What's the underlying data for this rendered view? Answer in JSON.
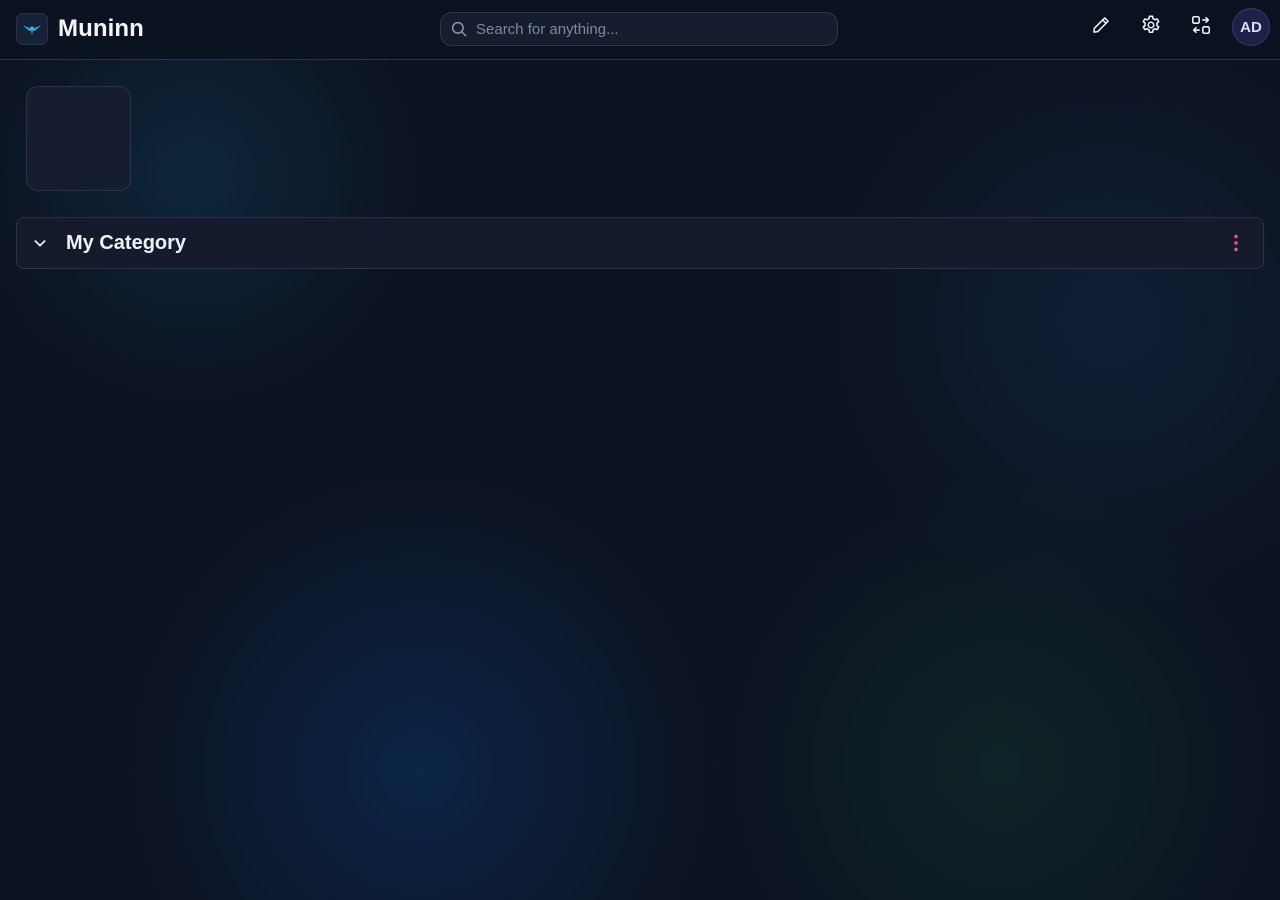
{
  "app": {
    "name": "Muninn",
    "logo_icon": "raven-logo-icon",
    "accent_color": "#3b9fe0"
  },
  "header": {
    "search": {
      "placeholder": "Search for anything...",
      "value": ""
    },
    "actions": [
      {
        "icon": "pencil-icon",
        "label": "Edit"
      },
      {
        "icon": "gear-icon",
        "label": "Settings"
      },
      {
        "icon": "switch-layout-icon",
        "label": "Switch"
      }
    ],
    "user": {
      "initials": "AD",
      "avatar_color": "#1e2147"
    }
  },
  "main": {
    "categories": [
      {
        "title": "My Category",
        "expanded": true,
        "menu_icon": "kebab-menu-icon",
        "menu_color": "#f25c7a"
      }
    ]
  }
}
